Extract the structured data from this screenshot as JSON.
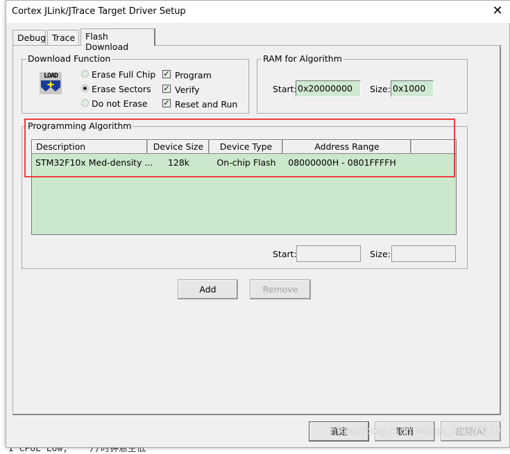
{
  "window": {
    "title": "Cortex JLink/JTrace Target Driver Setup"
  },
  "tabs": [
    {
      "label": "Debug"
    },
    {
      "label": "Trace"
    },
    {
      "label": "Flash Download",
      "active": true
    }
  ],
  "download_function": {
    "legend": "Download Function",
    "icon": "load-icon",
    "icon_text": "LOAD",
    "erase_options": [
      {
        "label": "Erase Full Chip",
        "selected": false
      },
      {
        "label": "Erase Sectors",
        "selected": true
      },
      {
        "label": "Do not Erase",
        "selected": false
      }
    ],
    "checks": [
      {
        "label": "Program",
        "checked": true
      },
      {
        "label": "Verify",
        "checked": true
      },
      {
        "label": "Reset and Run",
        "checked": true
      }
    ]
  },
  "ram": {
    "legend": "RAM for Algorithm",
    "start_label": "Start:",
    "start_value": "0x20000000",
    "size_label": "Size:",
    "size_value": "0x1000"
  },
  "algorithm": {
    "legend": "Programming Algorithm",
    "columns": [
      "Description",
      "Device Size",
      "Device Type",
      "Address Range"
    ],
    "rows": [
      [
        "STM32F10x Med-density ...",
        "128k",
        "On-chip Flash",
        "08000000H - 0801FFFFH"
      ]
    ],
    "start_label": "Start:",
    "start_value": "",
    "size_label": "Size:",
    "size_value": "",
    "add_label": "Add",
    "remove_label": "Remove"
  },
  "footer": {
    "ok_label": "确定",
    "cancel_label": "取消",
    "apply_label": "应用(A)"
  },
  "background": {
    "code_line": "I CPOL Low;    //时钟悬空低"
  },
  "watermark": "https://blog.csdn.net/qq_39927210",
  "colors": {
    "highlight": "#f03c3c",
    "field_bg": "#cfe8d2",
    "dialog_bg": "#f0f0f0"
  }
}
